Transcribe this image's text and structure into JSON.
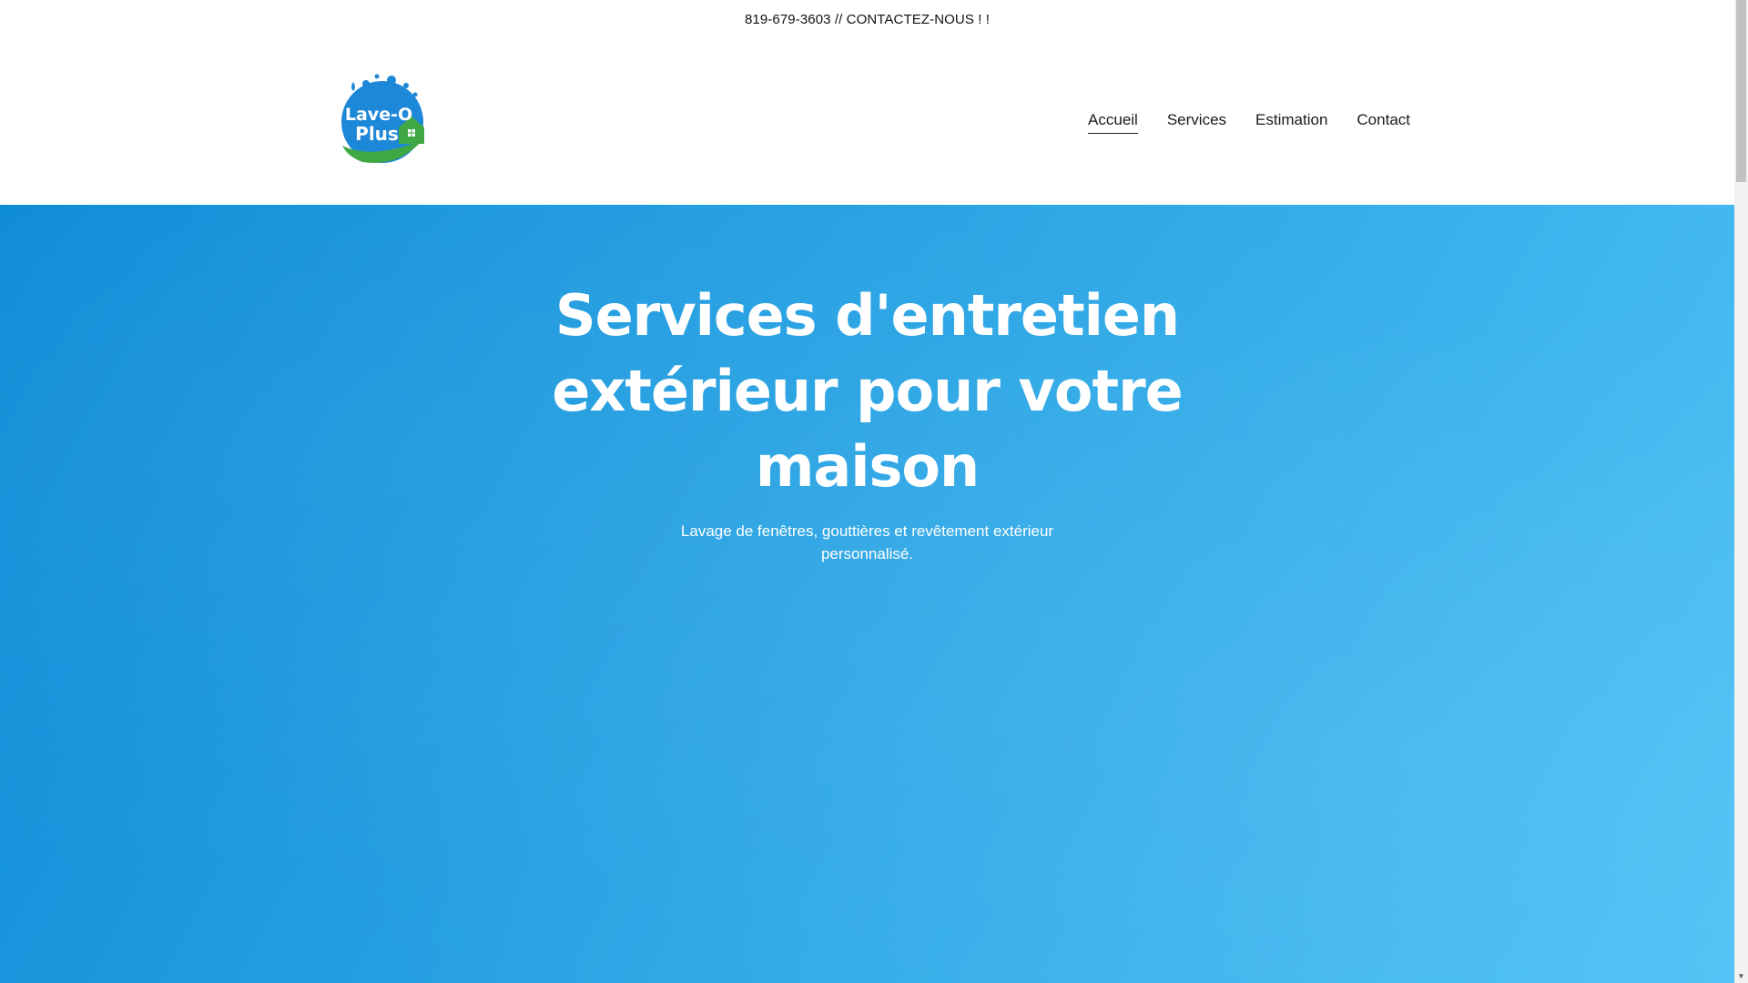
{
  "announcement": {
    "text": "819-679-3603 // CONTACTEZ-NOUS ! !"
  },
  "header": {
    "logo": {
      "line1": "Lave-O",
      "line2": "Plus"
    },
    "nav": [
      {
        "label": "Accueil",
        "active": true
      },
      {
        "label": "Services",
        "active": false
      },
      {
        "label": "Estimation",
        "active": false
      },
      {
        "label": "Contact",
        "active": false
      }
    ]
  },
  "hero": {
    "title_lines": [
      "Services d'entretien",
      "extérieur pour votre",
      "maison"
    ],
    "subtitle_lines": [
      "Lavage de fenêtres, gouttières et revêtement extérieur",
      "personnalisé."
    ]
  },
  "colors": {
    "hero_gradient_start": "#0b8ad6",
    "hero_gradient_end": "#4fc3f5",
    "logo_blue": "#1e88d8",
    "logo_green": "#3fa845"
  },
  "icons": {
    "scroll_down": "chevron-down-icon"
  }
}
